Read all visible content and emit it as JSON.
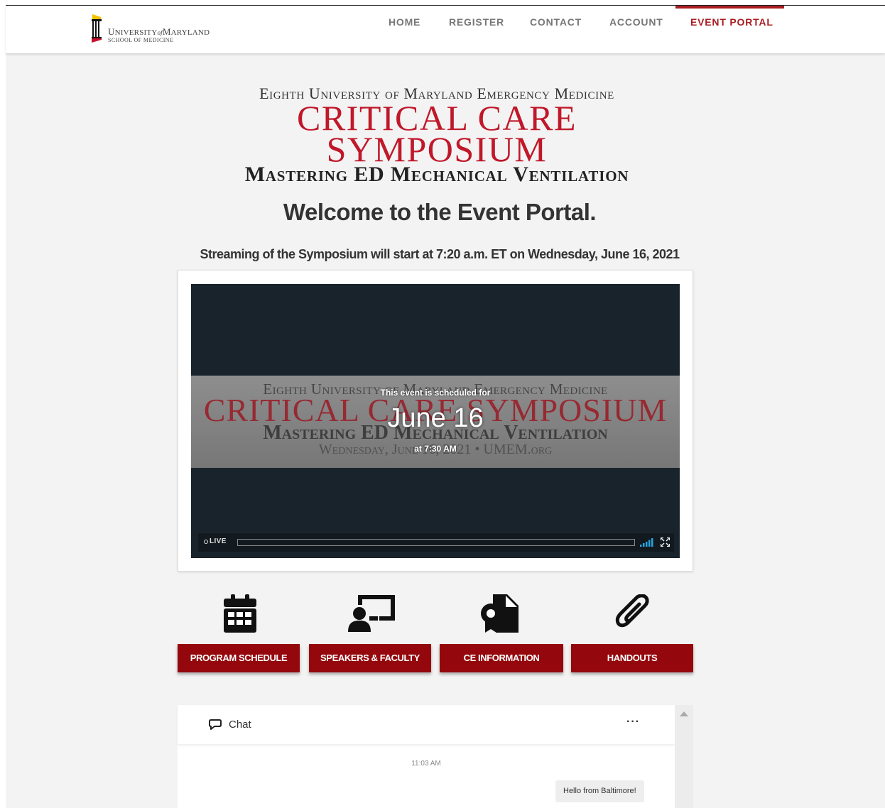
{
  "header": {
    "logo": {
      "line1_u": "U",
      "line1_rest": "NIVERSITY",
      "line1_of": "of",
      "line1_m": "M",
      "line1_rest2": "ARYLAND",
      "line2": "SCHOOL OF MEDICINE"
    },
    "nav": [
      {
        "label": "HOME"
      },
      {
        "label": "REGISTER"
      },
      {
        "label": "CONTACT"
      },
      {
        "label": "ACCOUNT"
      },
      {
        "label": "EVENT PORTAL",
        "active": true
      }
    ]
  },
  "banner": {
    "line1": "Eighth University of Maryland Emergency Medicine",
    "line2": "Critical Care Symposium",
    "line3": "Mastering ED Mechanical Ventilation"
  },
  "welcome": "Welcome to the Event Portal.",
  "streaming_note": "Streaming of the Symposium will start at 7:20 a.m. ET on Wednesday, June 16, 2021",
  "player": {
    "poster": {
      "line1": "Eighth University of Maryland Emergency Medicine",
      "line2": "Critical Care Symposium",
      "line3": "Mastering ED Mechanical Ventilation",
      "line4": "Wednesday, June 16, 2021 • UMEM.org"
    },
    "scheduled_label": "This event is scheduled for",
    "scheduled_date": "June 16",
    "scheduled_time": "at 7:30 AM",
    "live_label": "LIVE"
  },
  "resources": [
    {
      "label": "PROGRAM SCHEDULE",
      "icon": "calendar-icon"
    },
    {
      "label": "SPEAKERS & FACULTY",
      "icon": "presenter-icon"
    },
    {
      "label": "CE INFORMATION",
      "icon": "certificate-icon"
    },
    {
      "label": "HANDOUTS",
      "icon": "paperclip-icon"
    }
  ],
  "chat": {
    "title": "Chat",
    "more": "···",
    "timestamp": "11:03 AM",
    "message": "Hello from Baltimore!"
  },
  "colors": {
    "accent": "#a81d22",
    "button": "#94080d",
    "banner_red": "#c0182a",
    "player_bg": "#19232b"
  }
}
